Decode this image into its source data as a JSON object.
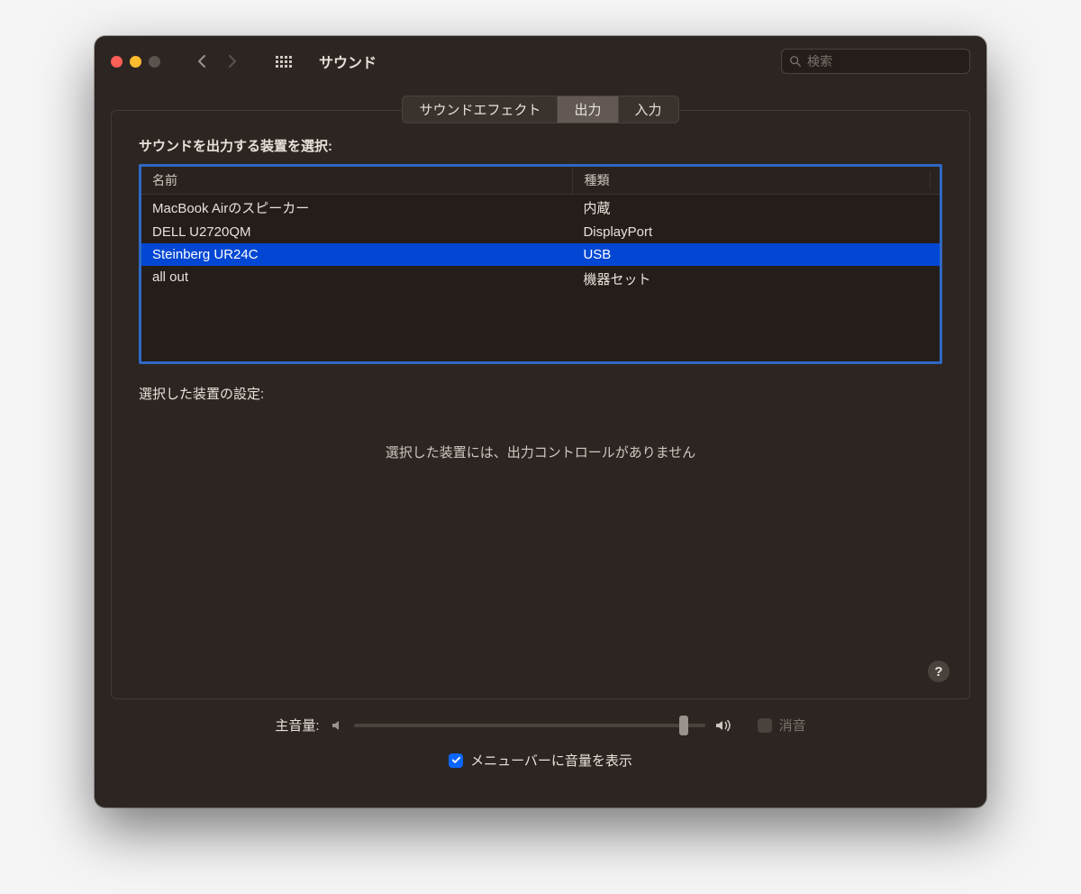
{
  "window_title": "サウンド",
  "search_placeholder": "検索",
  "tabs": {
    "effects": "サウンドエフェクト",
    "output": "出力",
    "input": "入力"
  },
  "section_label": "サウンドを出力する装置を選択:",
  "columns": {
    "name": "名前",
    "type": "種類"
  },
  "devices": [
    {
      "name": "MacBook Airのスピーカー",
      "type": "内蔵",
      "selected": false
    },
    {
      "name": "DELL U2720QM",
      "type": "DisplayPort",
      "selected": false
    },
    {
      "name": "Steinberg UR24C",
      "type": "USB",
      "selected": true
    },
    {
      "name": "all out",
      "type": "機器セット",
      "selected": false
    }
  ],
  "settings_label": "選択した装置の設定:",
  "no_controls_message": "選択した装置には、出力コントロールがありません",
  "help_label": "?",
  "volume": {
    "label": "主音量:",
    "value_percent": 94,
    "mute_label": "消音",
    "mute_checked": false
  },
  "menubar": {
    "label": "メニューバーに音量を表示",
    "checked": true
  }
}
